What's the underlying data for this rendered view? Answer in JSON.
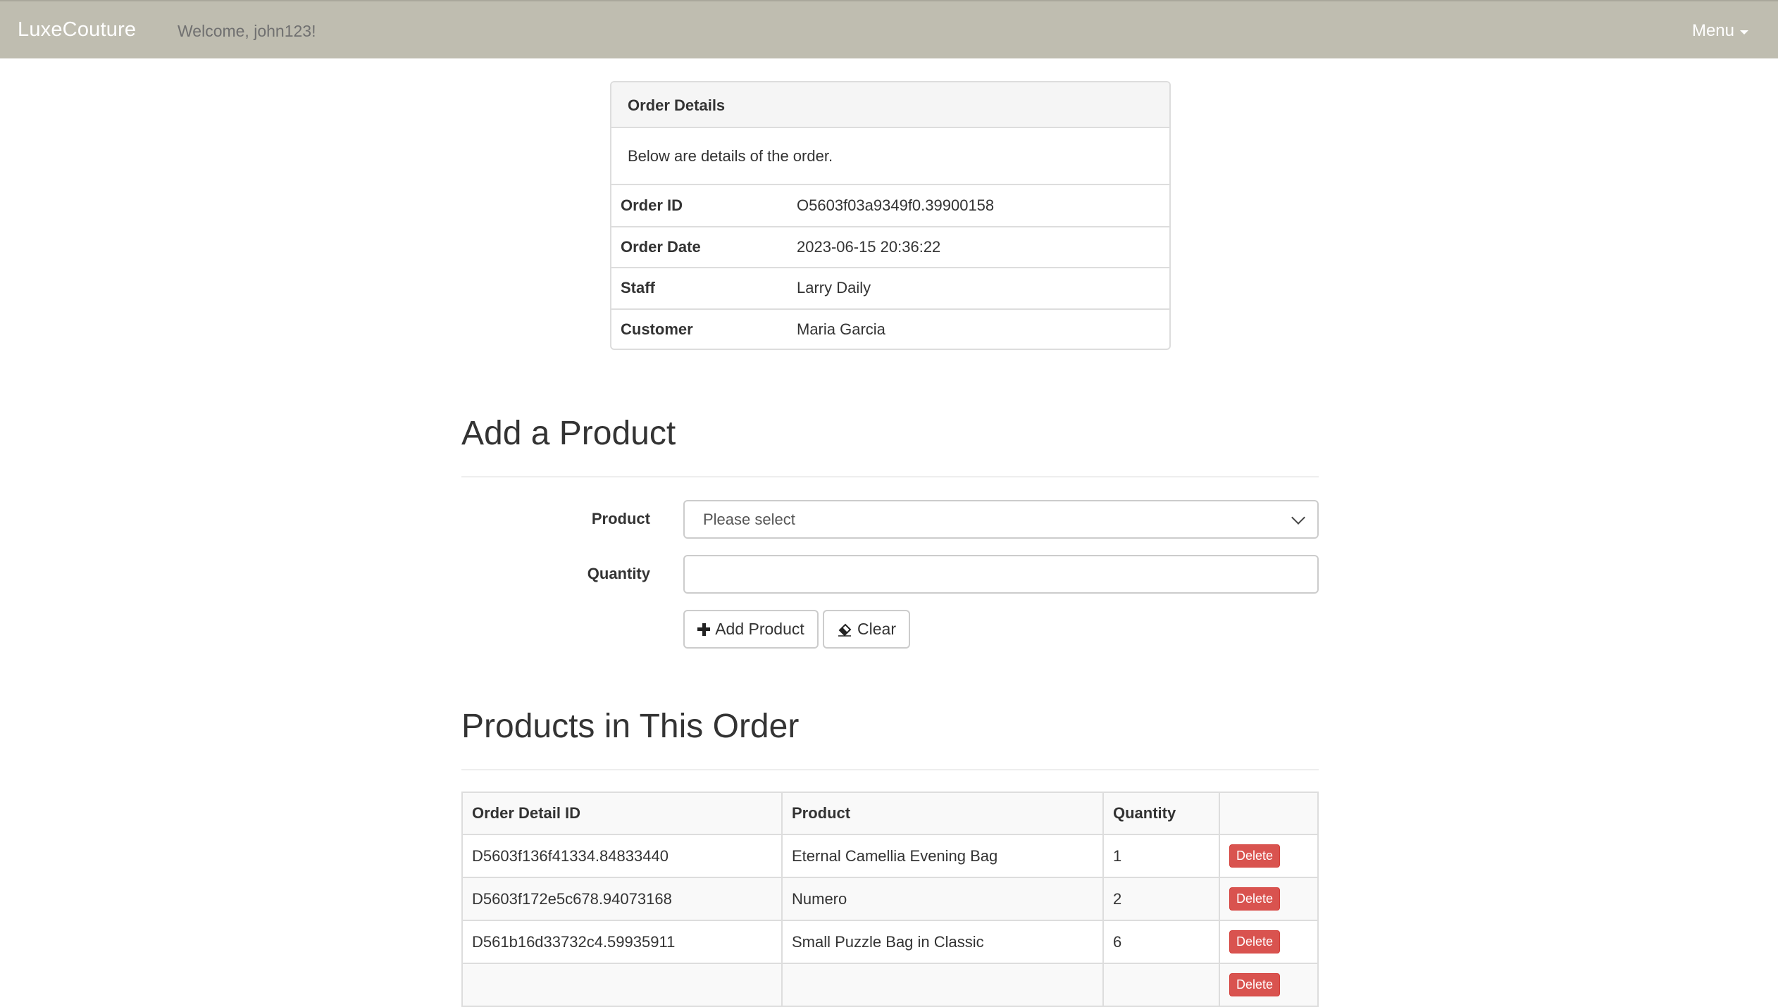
{
  "navbar": {
    "brand": "LuxeCouture",
    "welcome": "Welcome, john123!",
    "menu_label": "Menu"
  },
  "order_panel": {
    "heading": "Order Details",
    "description": "Below are details of the order.",
    "rows": [
      {
        "label": "Order ID",
        "value": "O5603f03a9349f0.39900158"
      },
      {
        "label": "Order Date",
        "value": "2023-06-15 20:36:22"
      },
      {
        "label": "Staff",
        "value": "Larry Daily"
      },
      {
        "label": "Customer",
        "value": "Maria Garcia"
      }
    ]
  },
  "add_product": {
    "title": "Add a Product",
    "product_label": "Product",
    "product_selected": "Please select",
    "quantity_label": "Quantity",
    "quantity_value": "",
    "add_button": "Add Product",
    "clear_button": "Clear"
  },
  "products": {
    "title": "Products in This Order",
    "columns": [
      "Order Detail ID",
      "Product",
      "Quantity",
      ""
    ],
    "delete_label": "Delete",
    "rows": [
      {
        "id": "D5603f136f41334.84833440",
        "product": "Eternal Camellia Evening Bag",
        "quantity": "1"
      },
      {
        "id": "D5603f172e5c678.94073168",
        "product": "Numero",
        "quantity": "2"
      },
      {
        "id": "D561b16d33732c4.59935911",
        "product": "Small Puzzle Bag in Classic",
        "quantity": "6"
      }
    ]
  },
  "colors": {
    "navbar_bg": "#bfbdb0",
    "delete_red": "#d9534f"
  }
}
